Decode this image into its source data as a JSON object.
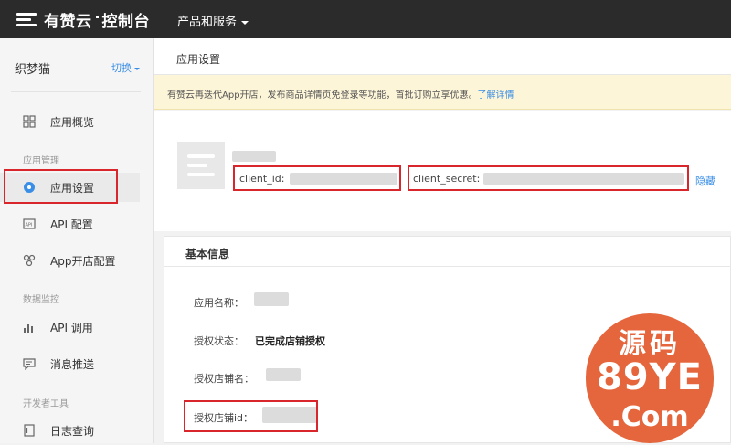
{
  "topbar": {
    "logo_text": "有赞云",
    "logo_suffix": "控制台",
    "products_label": "产品和服务"
  },
  "sidebar": {
    "store_name": "织梦猫",
    "switch_label": "切换",
    "items": [
      {
        "label": "应用概览",
        "icon": "grid-icon"
      },
      {
        "label": "应用设置",
        "icon": "settings-dot-icon",
        "active": true
      },
      {
        "label": "API 配置",
        "icon": "api-config-icon"
      },
      {
        "label": "App开店配置",
        "icon": "share-nodes-icon"
      },
      {
        "label": "API 调用",
        "icon": "bar-chart-icon"
      },
      {
        "label": "消息推送",
        "icon": "message-icon"
      },
      {
        "label": "日志查询",
        "icon": "log-icon"
      }
    ],
    "sections": [
      "应用管理",
      "数据监控",
      "开发者工具"
    ]
  },
  "main": {
    "page_title": "应用设置",
    "notice_text": "有赞云再迭代App开店，发布商品详情页免登录等功能，首批订购立享优惠。",
    "notice_link": "了解详情",
    "client_id_label": "client_id:",
    "client_secret_label": "client_secret:",
    "hide_link": "隐藏",
    "basic_info_title": "基本信息",
    "info_rows": [
      {
        "label": "应用名称：",
        "value": ""
      },
      {
        "label": "授权状态：",
        "value": "已完成店铺授权"
      },
      {
        "label": "授权店铺名：",
        "value": ""
      },
      {
        "label": "授权店铺id：",
        "value": ""
      }
    ]
  },
  "watermark": {
    "line1": "源码",
    "line2": "89YE",
    "line3": ".Com"
  },
  "colors": {
    "topbar": "#2b2b2b",
    "accent_blue": "#3a8ee6",
    "highlight_red": "#d9262c",
    "notice_bg": "#fdf5d8",
    "watermark": "#e35a2c"
  }
}
